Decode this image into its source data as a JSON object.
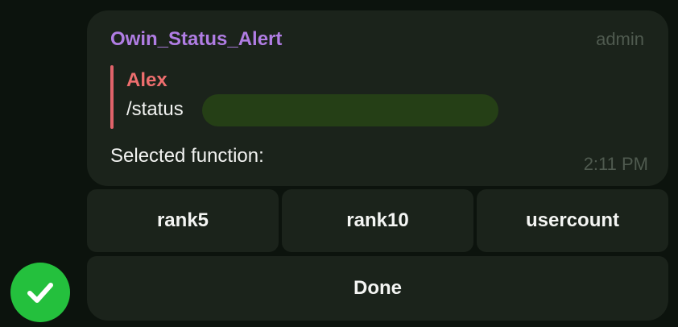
{
  "message": {
    "sender": "Owin_Status_Alert",
    "role": "admin",
    "reply": {
      "name": "Alex",
      "text": "/status"
    },
    "text": "Selected function:",
    "time": "2:11 PM"
  },
  "keyboard": {
    "rows": [
      [
        "rank5",
        "rank10",
        "usercount"
      ],
      [
        "Done"
      ]
    ]
  },
  "colors": {
    "background": "#0c130d",
    "bubble": "#1b231b",
    "sender_name": "#b07de3",
    "reply_accent": "#e0636a",
    "avatar": "#24c03d",
    "redaction": "#253f16"
  },
  "icons": {
    "avatar": "check-circle-icon"
  }
}
